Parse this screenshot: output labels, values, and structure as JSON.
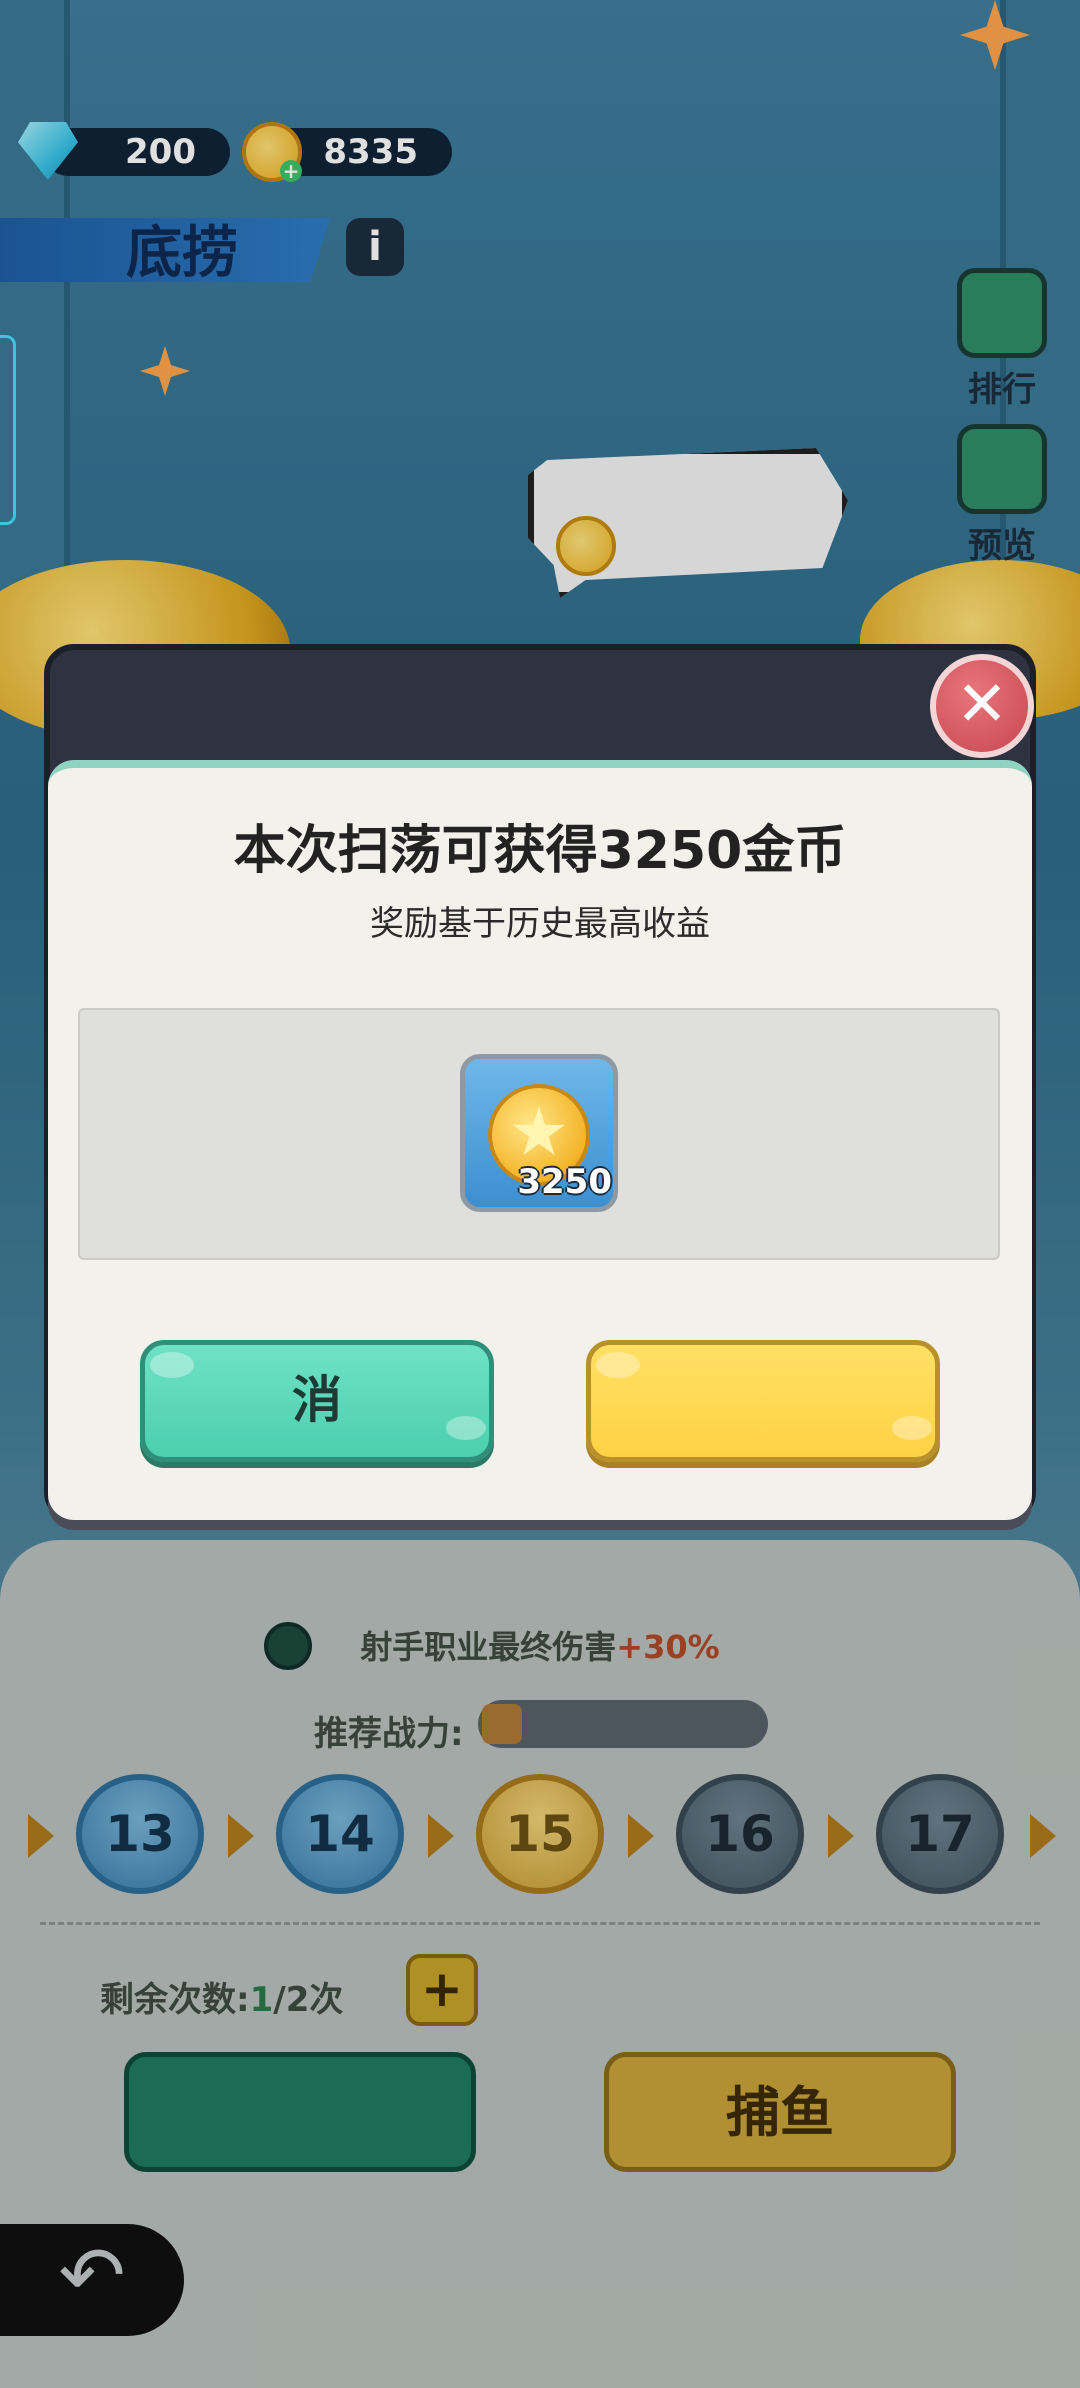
{
  "hud": {
    "gems": "200",
    "coins": "8335",
    "gem_icon": "diamond-icon",
    "coin_icon": "gold-coin-icon"
  },
  "stage": {
    "title": "底捞",
    "info_label": "i"
  },
  "side_buttons": [
    {
      "label": "排行",
      "icon": "ranking-icon"
    },
    {
      "label": "预览",
      "icon": "preview-icon"
    }
  ],
  "modal": {
    "title": "本次扫荡可获得3250金币",
    "subtitle": "奖励基于历史最高收益",
    "reward": {
      "icon": "gold-coin-icon",
      "count": "3250"
    },
    "cancel_label": "消",
    "confirm_label": "",
    "close_label": "✕"
  },
  "bottom": {
    "buff_text": "射手职业最终伤害",
    "buff_value": "+30%",
    "power_label": "推荐战力:",
    "levels": [
      "13",
      "14",
      "15",
      "16",
      "17"
    ],
    "remain_label": "剩余次数:",
    "remain_count": "1",
    "remain_total": "/2次",
    "plus_label": "+",
    "sweep_label": "",
    "fish_label": "捕鱼",
    "back_icon": "back-arrow-icon"
  },
  "colors": {
    "accent_teal": "#5cd9b9",
    "accent_yellow": "#ffd84f",
    "close_red": "#d24f58",
    "buff_red": "#b04a2a"
  }
}
